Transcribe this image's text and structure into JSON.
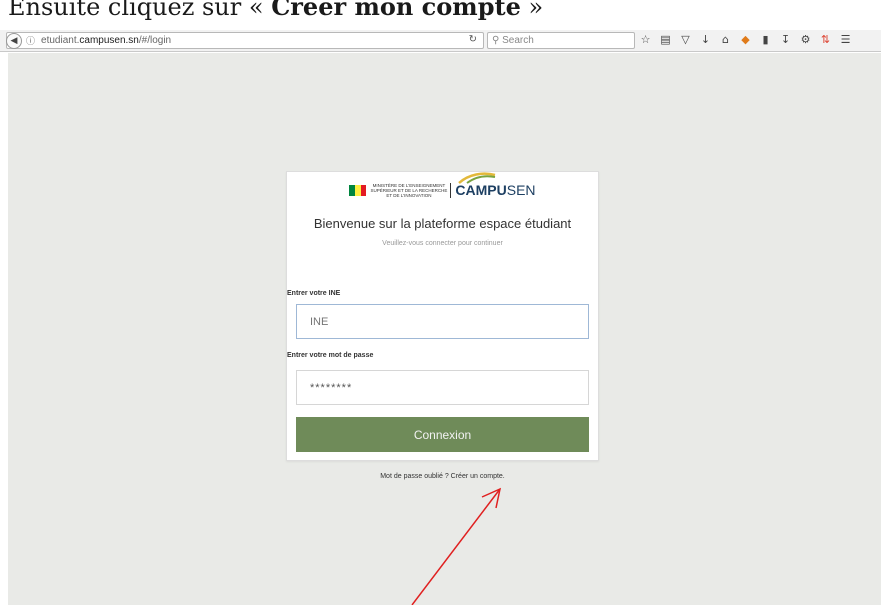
{
  "caption": {
    "prefix": "Ensuite cliquez sur « ",
    "bold": "Créer mon compte",
    "suffix": " »"
  },
  "browser": {
    "url_prefix": "etudiant.",
    "url_domain": "campusen.sn",
    "url_path": "/#/login",
    "search_placeholder": "Search"
  },
  "logo": {
    "ministry_line1": "MINISTÈRE DE L'ENSEIGNEMENT",
    "ministry_line2": "SUPÉRIEUR ET DE LA RECHERCHE",
    "ministry_line3": "ET DE L'INNOVATION",
    "brand_bold": "CAMPU",
    "brand_thin": "SEN"
  },
  "login": {
    "title": "Bienvenue sur la plateforme espace étudiant",
    "subtitle": "Veuillez-vous connecter pour continuer",
    "ine_label": "Entrer votre INE",
    "ine_placeholder": "INE",
    "password_label": "Entrer votre mot de passe",
    "password_value": "********",
    "submit_label": "Connexion",
    "forgot_link": "Mot de passe oublié ?",
    "create_link": "Créer un compte."
  },
  "colors": {
    "accent_button": "#6f8b59",
    "page_background": "#e9eae7",
    "annotation_arrow": "#e02020"
  }
}
